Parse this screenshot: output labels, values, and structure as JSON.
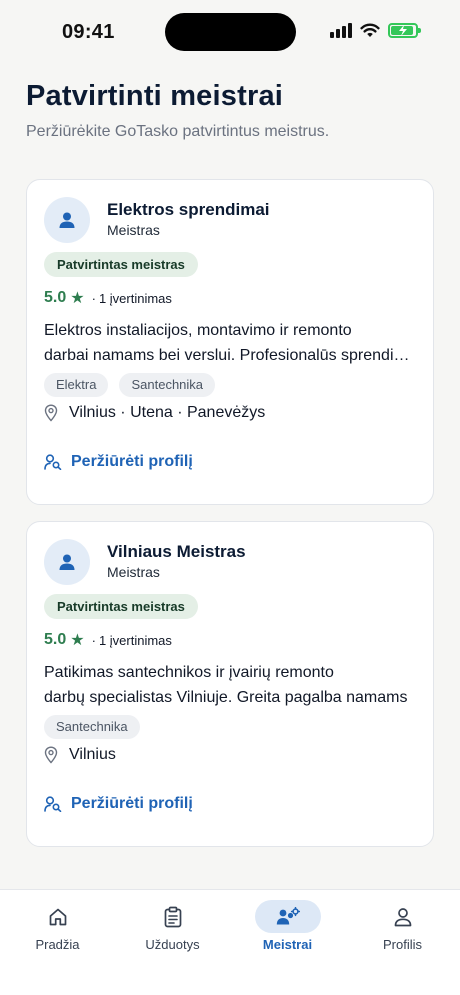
{
  "status_bar": {
    "time": "09:41"
  },
  "header": {
    "title": "Patvirtinti meistrai",
    "subtitle": "Peržiūrėkite GoTasko patvirtintus meistrus."
  },
  "cards": [
    {
      "name": "Elektros sprendimai",
      "role": "Meistras",
      "badge": "Patvirtintas meistras",
      "rating_score": "5.0",
      "rating_star": "★",
      "rating_sep": "·",
      "rating_count": "1 įvertinimas",
      "description_line1": "Elektros instaliacijos, montavimo ir remonto",
      "description_line2": "darbai namams bei verslui. Profesionalūs sprendimai",
      "tags": [
        "Elektra",
        "Santechnika"
      ],
      "location": "Vilnius · Utena · Panevėžys",
      "link_label": "Peržiūrėti profilį"
    },
    {
      "name": "Vilniaus Meistras",
      "role": "Meistras",
      "badge": "Patvirtintas meistras",
      "rating_score": "5.0",
      "rating_star": "★",
      "rating_sep": "·",
      "rating_count": "1 įvertinimas",
      "description_line1": "Patikimas santechnikos ir įvairių remonto",
      "description_line2": "darbų specialistas Vilniuje. Greita pagalba namams",
      "tags": [
        "Santechnika"
      ],
      "location": "Vilnius",
      "link_label": "Peržiūrėti profilį"
    }
  ],
  "nav": {
    "items": [
      {
        "label": "Pradžia",
        "icon": "home-icon",
        "active": false
      },
      {
        "label": "Užduotys",
        "icon": "clipboard-icon",
        "active": false
      },
      {
        "label": "Meistrai",
        "icon": "users-gear-icon",
        "active": true
      },
      {
        "label": "Profilis",
        "icon": "user-icon",
        "active": false
      }
    ]
  },
  "colors": {
    "accent": "#1f63b5",
    "rating_green": "#2e7d4f",
    "badge_bg": "#e4efe6",
    "background": "#f6f6f4"
  }
}
